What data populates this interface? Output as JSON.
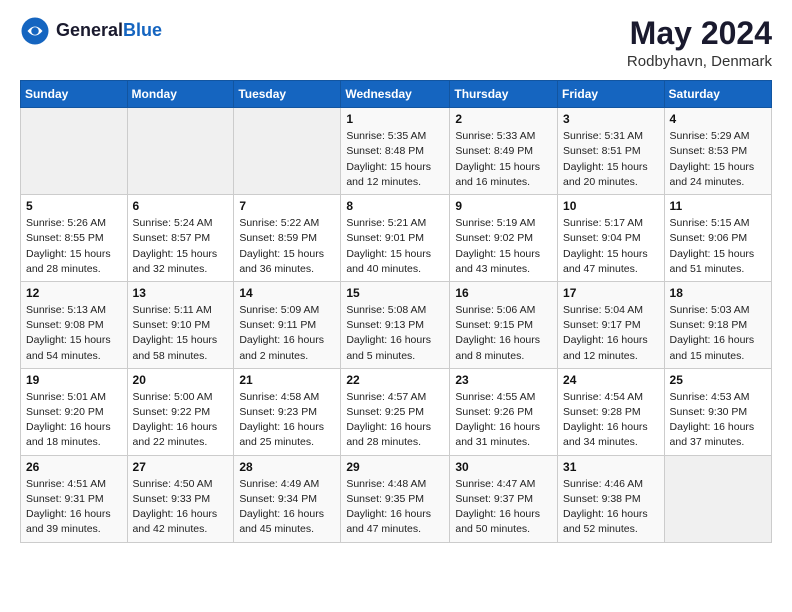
{
  "header": {
    "logo_general": "General",
    "logo_blue": "Blue",
    "title": "May 2024",
    "subtitle": "Rodbyhavn, Denmark"
  },
  "days_of_week": [
    "Sunday",
    "Monday",
    "Tuesday",
    "Wednesday",
    "Thursday",
    "Friday",
    "Saturday"
  ],
  "weeks": [
    [
      {
        "day": "",
        "info": ""
      },
      {
        "day": "",
        "info": ""
      },
      {
        "day": "",
        "info": ""
      },
      {
        "day": "1",
        "info": "Sunrise: 5:35 AM\nSunset: 8:48 PM\nDaylight: 15 hours\nand 12 minutes."
      },
      {
        "day": "2",
        "info": "Sunrise: 5:33 AM\nSunset: 8:49 PM\nDaylight: 15 hours\nand 16 minutes."
      },
      {
        "day": "3",
        "info": "Sunrise: 5:31 AM\nSunset: 8:51 PM\nDaylight: 15 hours\nand 20 minutes."
      },
      {
        "day": "4",
        "info": "Sunrise: 5:29 AM\nSunset: 8:53 PM\nDaylight: 15 hours\nand 24 minutes."
      }
    ],
    [
      {
        "day": "5",
        "info": "Sunrise: 5:26 AM\nSunset: 8:55 PM\nDaylight: 15 hours\nand 28 minutes."
      },
      {
        "day": "6",
        "info": "Sunrise: 5:24 AM\nSunset: 8:57 PM\nDaylight: 15 hours\nand 32 minutes."
      },
      {
        "day": "7",
        "info": "Sunrise: 5:22 AM\nSunset: 8:59 PM\nDaylight: 15 hours\nand 36 minutes."
      },
      {
        "day": "8",
        "info": "Sunrise: 5:21 AM\nSunset: 9:01 PM\nDaylight: 15 hours\nand 40 minutes."
      },
      {
        "day": "9",
        "info": "Sunrise: 5:19 AM\nSunset: 9:02 PM\nDaylight: 15 hours\nand 43 minutes."
      },
      {
        "day": "10",
        "info": "Sunrise: 5:17 AM\nSunset: 9:04 PM\nDaylight: 15 hours\nand 47 minutes."
      },
      {
        "day": "11",
        "info": "Sunrise: 5:15 AM\nSunset: 9:06 PM\nDaylight: 15 hours\nand 51 minutes."
      }
    ],
    [
      {
        "day": "12",
        "info": "Sunrise: 5:13 AM\nSunset: 9:08 PM\nDaylight: 15 hours\nand 54 minutes."
      },
      {
        "day": "13",
        "info": "Sunrise: 5:11 AM\nSunset: 9:10 PM\nDaylight: 15 hours\nand 58 minutes."
      },
      {
        "day": "14",
        "info": "Sunrise: 5:09 AM\nSunset: 9:11 PM\nDaylight: 16 hours\nand 2 minutes."
      },
      {
        "day": "15",
        "info": "Sunrise: 5:08 AM\nSunset: 9:13 PM\nDaylight: 16 hours\nand 5 minutes."
      },
      {
        "day": "16",
        "info": "Sunrise: 5:06 AM\nSunset: 9:15 PM\nDaylight: 16 hours\nand 8 minutes."
      },
      {
        "day": "17",
        "info": "Sunrise: 5:04 AM\nSunset: 9:17 PM\nDaylight: 16 hours\nand 12 minutes."
      },
      {
        "day": "18",
        "info": "Sunrise: 5:03 AM\nSunset: 9:18 PM\nDaylight: 16 hours\nand 15 minutes."
      }
    ],
    [
      {
        "day": "19",
        "info": "Sunrise: 5:01 AM\nSunset: 9:20 PM\nDaylight: 16 hours\nand 18 minutes."
      },
      {
        "day": "20",
        "info": "Sunrise: 5:00 AM\nSunset: 9:22 PM\nDaylight: 16 hours\nand 22 minutes."
      },
      {
        "day": "21",
        "info": "Sunrise: 4:58 AM\nSunset: 9:23 PM\nDaylight: 16 hours\nand 25 minutes."
      },
      {
        "day": "22",
        "info": "Sunrise: 4:57 AM\nSunset: 9:25 PM\nDaylight: 16 hours\nand 28 minutes."
      },
      {
        "day": "23",
        "info": "Sunrise: 4:55 AM\nSunset: 9:26 PM\nDaylight: 16 hours\nand 31 minutes."
      },
      {
        "day": "24",
        "info": "Sunrise: 4:54 AM\nSunset: 9:28 PM\nDaylight: 16 hours\nand 34 minutes."
      },
      {
        "day": "25",
        "info": "Sunrise: 4:53 AM\nSunset: 9:30 PM\nDaylight: 16 hours\nand 37 minutes."
      }
    ],
    [
      {
        "day": "26",
        "info": "Sunrise: 4:51 AM\nSunset: 9:31 PM\nDaylight: 16 hours\nand 39 minutes."
      },
      {
        "day": "27",
        "info": "Sunrise: 4:50 AM\nSunset: 9:33 PM\nDaylight: 16 hours\nand 42 minutes."
      },
      {
        "day": "28",
        "info": "Sunrise: 4:49 AM\nSunset: 9:34 PM\nDaylight: 16 hours\nand 45 minutes."
      },
      {
        "day": "29",
        "info": "Sunrise: 4:48 AM\nSunset: 9:35 PM\nDaylight: 16 hours\nand 47 minutes."
      },
      {
        "day": "30",
        "info": "Sunrise: 4:47 AM\nSunset: 9:37 PM\nDaylight: 16 hours\nand 50 minutes."
      },
      {
        "day": "31",
        "info": "Sunrise: 4:46 AM\nSunset: 9:38 PM\nDaylight: 16 hours\nand 52 minutes."
      },
      {
        "day": "",
        "info": ""
      }
    ]
  ]
}
